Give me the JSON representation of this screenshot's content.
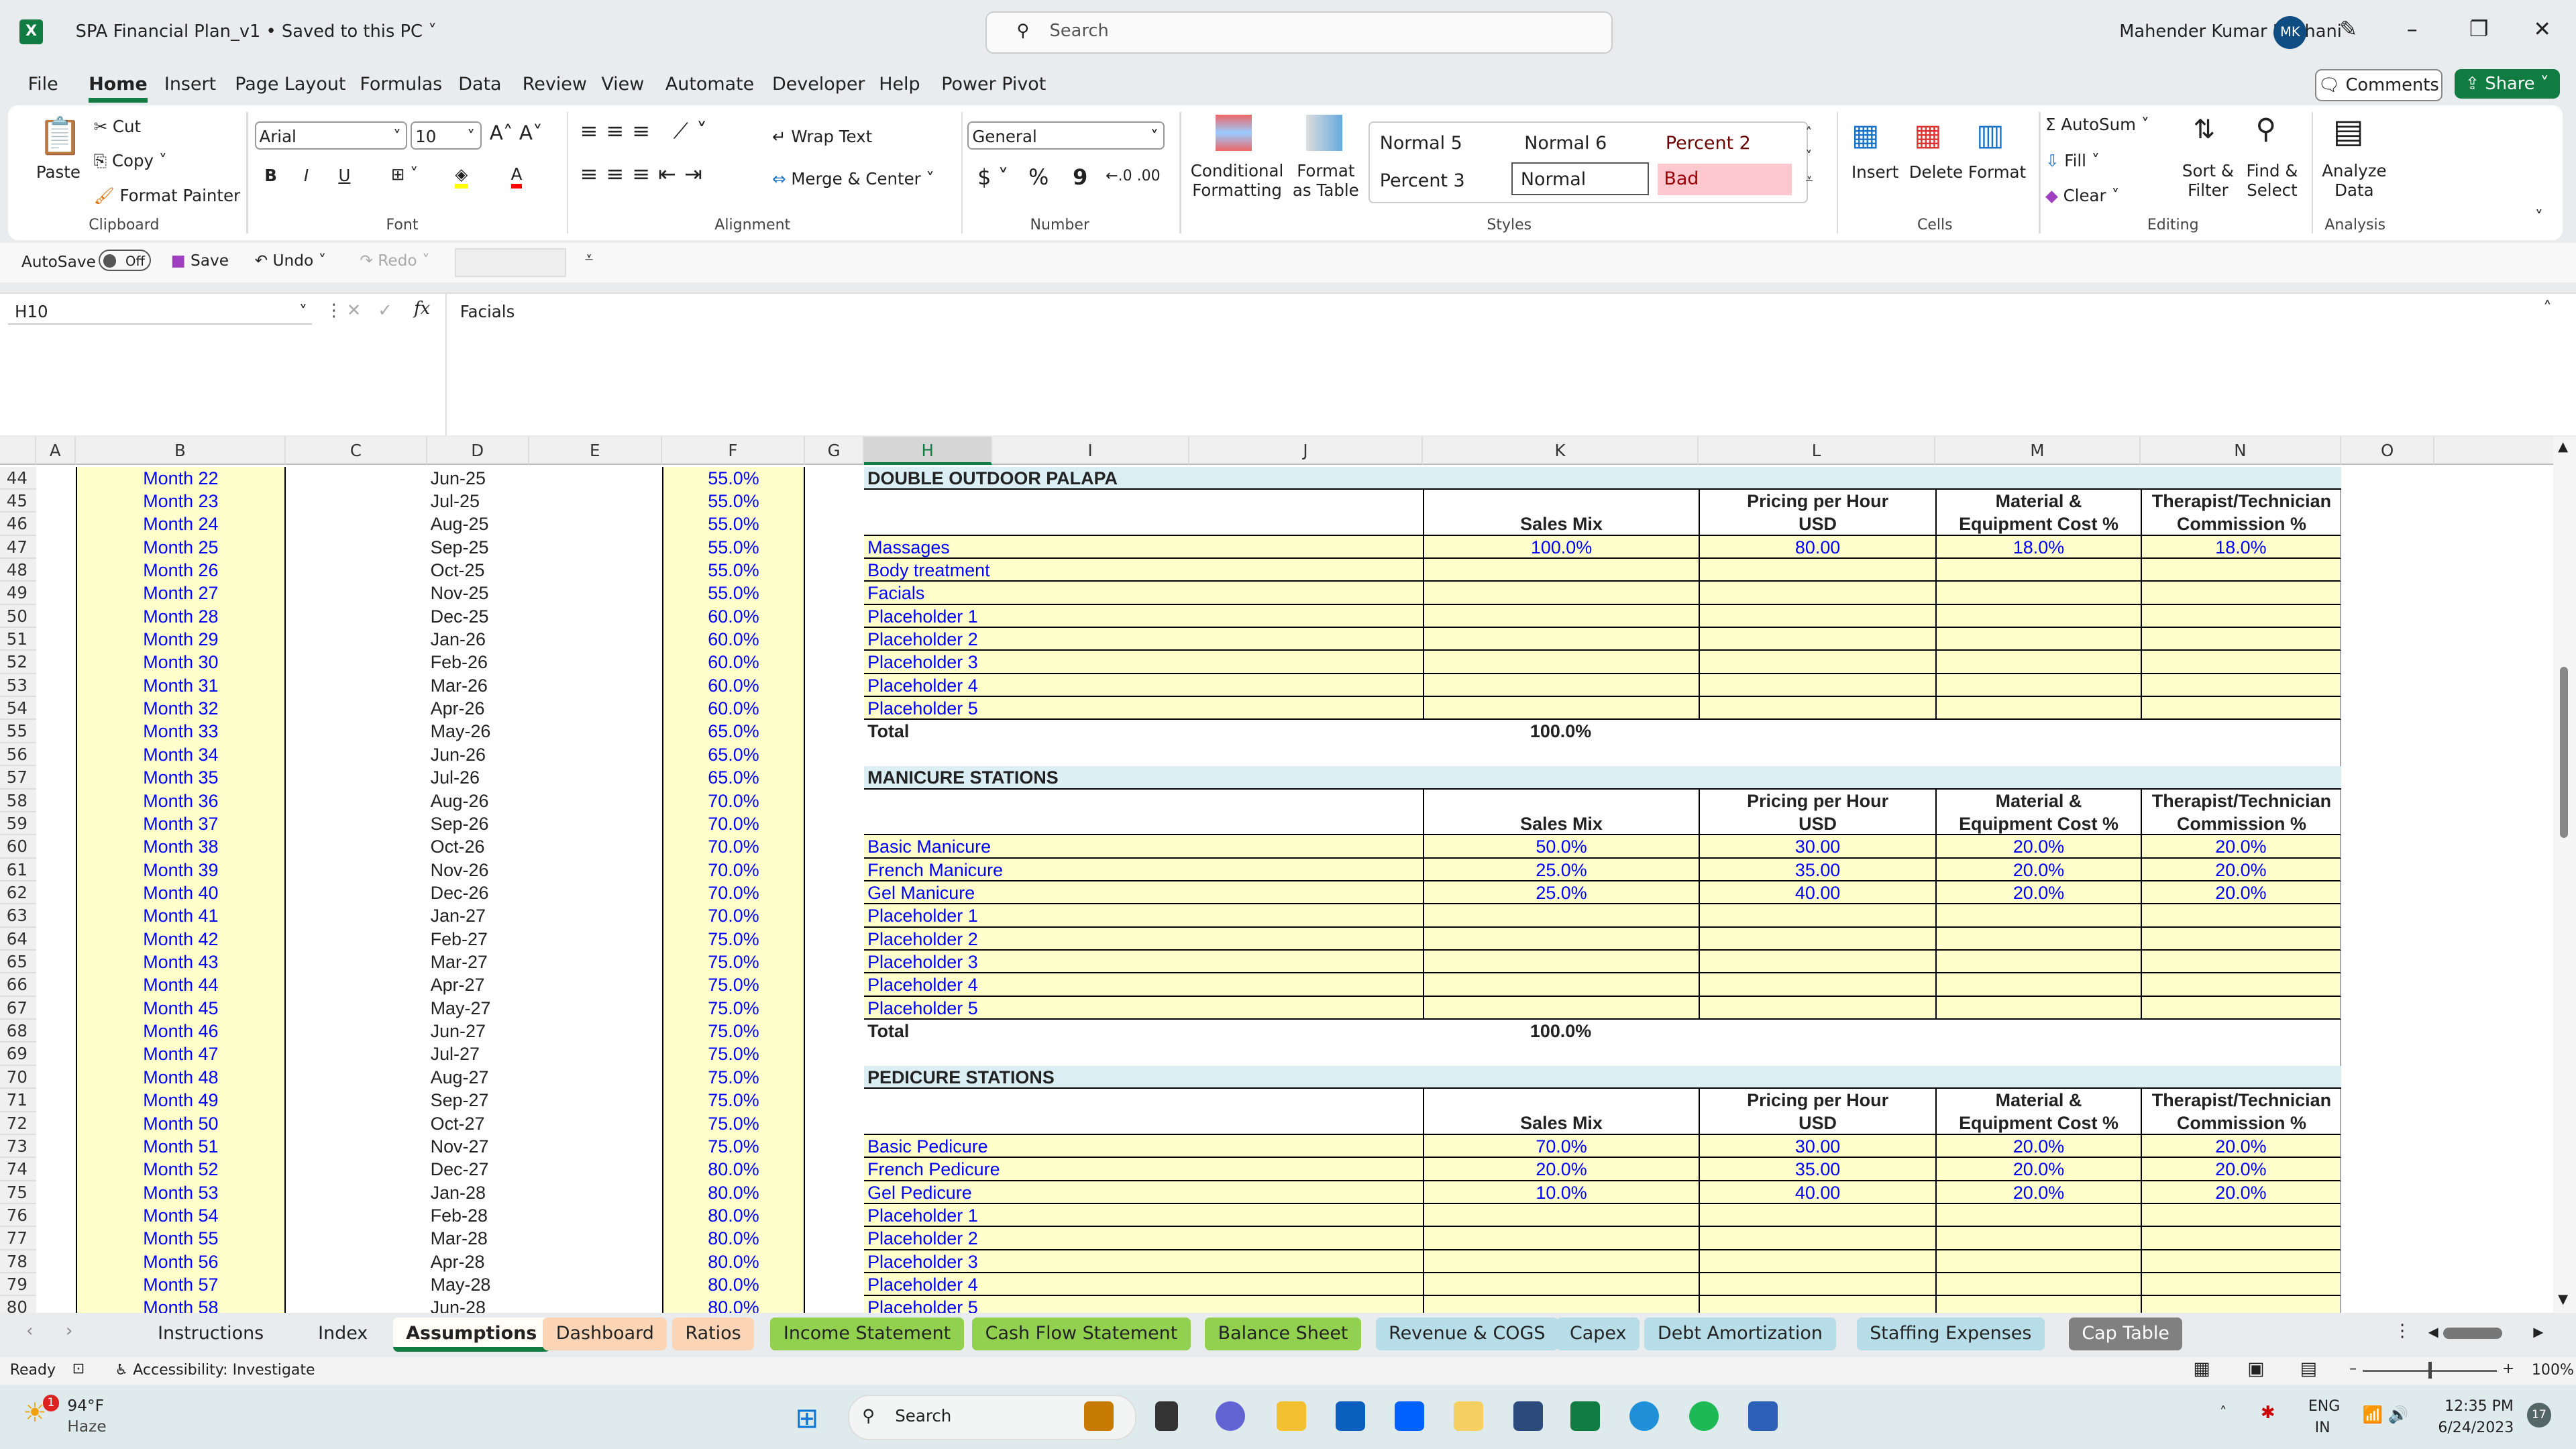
{
  "window": {
    "title": "SPA Financial Plan_v1 • Saved to this PC ˅",
    "search_placeholder": "Search",
    "user": "Mahender Kumar Punhani",
    "avatar": "MK"
  },
  "menu": [
    "File",
    "Home",
    "Insert",
    "Page Layout",
    "Formulas",
    "Data",
    "Review",
    "View",
    "Automate",
    "Developer",
    "Help",
    "Power Pivot"
  ],
  "menu_active": "Home",
  "actions": {
    "comments": "Comments",
    "share": "Share"
  },
  "ribbon": {
    "clipboard": {
      "paste": "Paste",
      "cut": "Cut",
      "copy": "Copy",
      "format_painter": "Format Painter",
      "label": "Clipboard"
    },
    "font": {
      "name": "Arial",
      "size": "10",
      "label": "Font",
      "bold": "B",
      "italic": "I",
      "underline": "U"
    },
    "alignment": {
      "wrap": "Wrap Text",
      "merge": "Merge & Center",
      "label": "Alignment"
    },
    "number": {
      "format": "General",
      "label": "Number",
      "currency": "$",
      "percent": "%",
      "comma": "9"
    },
    "styles": {
      "conditional": "Conditional Formatting",
      "format_table": "Format as Table",
      "cells": [
        "Normal 5",
        "Normal 6",
        "Percent 2",
        "Percent 3",
        "Normal",
        "Bad"
      ],
      "label": "Styles"
    },
    "cells": {
      "insert": "Insert",
      "delete": "Delete",
      "format": "Format",
      "label": "Cells"
    },
    "editing": {
      "autosum": "AutoSum",
      "fill": "Fill",
      "clear": "Clear",
      "sort": "Sort & Filter",
      "find": "Find & Select",
      "label": "Editing"
    },
    "analysis": {
      "analyze": "Analyze Data",
      "label": "Analysis"
    }
  },
  "qat": {
    "autosave": "AutoSave",
    "toggle": "Off",
    "save": "Save",
    "undo": "Undo",
    "redo": "Redo"
  },
  "formula_bar": {
    "name_box": "H10",
    "fx": "fx",
    "content": "Facials"
  },
  "columns": [
    "A",
    "B",
    "C",
    "D",
    "E",
    "F",
    "G",
    "H",
    "I",
    "J",
    "K",
    "L",
    "M",
    "N",
    "O"
  ],
  "selected_column": "H",
  "first_row": 44,
  "left_table": {
    "months": [
      "Month 22",
      "Month 23",
      "Month 24",
      "Month 25",
      "Month 26",
      "Month 27",
      "Month 28",
      "Month 29",
      "Month 30",
      "Month 31",
      "Month 32",
      "Month 33",
      "Month 34",
      "Month 35",
      "Month 36",
      "Month 37",
      "Month 38",
      "Month 39",
      "Month 40",
      "Month 41",
      "Month 42",
      "Month 43",
      "Month 44",
      "Month 45",
      "Month 46",
      "Month 47",
      "Month 48",
      "Month 49",
      "Month 50",
      "Month 51",
      "Month 52",
      "Month 53",
      "Month 54",
      "Month 55",
      "Month 56",
      "Month 57",
      "Month 58"
    ],
    "dates": [
      "Jun-25",
      "Jul-25",
      "Aug-25",
      "Sep-25",
      "Oct-25",
      "Nov-25",
      "Dec-25",
      "Jan-26",
      "Feb-26",
      "Mar-26",
      "Apr-26",
      "May-26",
      "Jun-26",
      "Jul-26",
      "Aug-26",
      "Sep-26",
      "Oct-26",
      "Nov-26",
      "Dec-26",
      "Jan-27",
      "Feb-27",
      "Mar-27",
      "Apr-27",
      "May-27",
      "Jun-27",
      "Jul-27",
      "Aug-27",
      "Sep-27",
      "Oct-27",
      "Nov-27",
      "Dec-27",
      "Jan-28",
      "Feb-28",
      "Mar-28",
      "Apr-28",
      "May-28",
      "Jun-28"
    ],
    "pct": [
      "55.0%",
      "55.0%",
      "55.0%",
      "55.0%",
      "55.0%",
      "55.0%",
      "60.0%",
      "60.0%",
      "60.0%",
      "60.0%",
      "60.0%",
      "65.0%",
      "65.0%",
      "65.0%",
      "70.0%",
      "70.0%",
      "70.0%",
      "70.0%",
      "70.0%",
      "70.0%",
      "75.0%",
      "75.0%",
      "75.0%",
      "75.0%",
      "75.0%",
      "75.0%",
      "75.0%",
      "75.0%",
      "75.0%",
      "75.0%",
      "80.0%",
      "80.0%",
      "80.0%",
      "80.0%",
      "80.0%",
      "80.0%",
      "80.0%"
    ]
  },
  "headers": {
    "sales_mix": "Sales Mix",
    "pricing": [
      "Pricing per Hour",
      "USD"
    ],
    "material": [
      "Material &",
      "Equipment Cost %"
    ],
    "commission": [
      "Therapist/Technician",
      "Commission %"
    ],
    "total": "Total"
  },
  "sections": [
    {
      "title": "DOUBLE OUTDOOR PALAPA",
      "total": "100.0%",
      "items": [
        {
          "name": "Massages",
          "mix": "100.0%",
          "price": "80.00",
          "material": "18.0%",
          "commission": "18.0%"
        },
        {
          "name": "Body treatment"
        },
        {
          "name": "Facials"
        },
        {
          "name": "Placeholder 1"
        },
        {
          "name": "Placeholder 2"
        },
        {
          "name": "Placeholder 3"
        },
        {
          "name": "Placeholder 4"
        },
        {
          "name": "Placeholder 5"
        }
      ]
    },
    {
      "title": "MANICURE STATIONS",
      "total": "100.0%",
      "items": [
        {
          "name": "Basic Manicure",
          "mix": "50.0%",
          "price": "30.00",
          "material": "20.0%",
          "commission": "20.0%"
        },
        {
          "name": "French Manicure",
          "mix": "25.0%",
          "price": "35.00",
          "material": "20.0%",
          "commission": "20.0%"
        },
        {
          "name": "Gel Manicure",
          "mix": "25.0%",
          "price": "40.00",
          "material": "20.0%",
          "commission": "20.0%"
        },
        {
          "name": "Placeholder 1"
        },
        {
          "name": "Placeholder 2"
        },
        {
          "name": "Placeholder 3"
        },
        {
          "name": "Placeholder 4"
        },
        {
          "name": "Placeholder 5"
        }
      ]
    },
    {
      "title": "PEDICURE STATIONS",
      "items": [
        {
          "name": "Basic Pedicure",
          "mix": "70.0%",
          "price": "30.00",
          "material": "20.0%",
          "commission": "20.0%"
        },
        {
          "name": "French Pedicure",
          "mix": "20.0%",
          "price": "35.00",
          "material": "20.0%",
          "commission": "20.0%"
        },
        {
          "name": "Gel Pedicure",
          "mix": "10.0%",
          "price": "40.00",
          "material": "20.0%",
          "commission": "20.0%"
        },
        {
          "name": "Placeholder 1"
        },
        {
          "name": "Placeholder 2"
        },
        {
          "name": "Placeholder 3"
        },
        {
          "name": "Placeholder 4"
        },
        {
          "name": "Placeholder 5"
        }
      ]
    }
  ],
  "sheet_tabs": [
    {
      "label": "Instructions",
      "color": ""
    },
    {
      "label": "Index",
      "color": ""
    },
    {
      "label": "Assumptions",
      "color": "",
      "active": true
    },
    {
      "label": "Dashboard",
      "color": "#fbd5b5"
    },
    {
      "label": "Ratios",
      "color": "#fbd5b5"
    },
    {
      "label": "Income Statement",
      "color": "#92d050"
    },
    {
      "label": "Cash Flow Statement",
      "color": "#92d050"
    },
    {
      "label": "Balance Sheet",
      "color": "#92d050"
    },
    {
      "label": "Revenue & COGS",
      "color": "#b7dee8"
    },
    {
      "label": "Capex",
      "color": "#b7dee8"
    },
    {
      "label": "Debt Amortization",
      "color": "#b7dee8"
    },
    {
      "label": "Staffing Expenses",
      "color": "#b7dee8"
    },
    {
      "label": "Cap Table",
      "color": "#808080"
    }
  ],
  "status": {
    "ready": "Ready",
    "accessibility": "Accessibility: Investigate",
    "zoom": "100%"
  },
  "taskbar": {
    "temp": "94°F",
    "weather": "Haze",
    "search": "Search",
    "lang1": "ENG",
    "lang2": "IN",
    "time": "12:35 PM",
    "date": "6/24/2023",
    "badge": "17",
    "weather_badge": "1"
  },
  "colors": {
    "accent": "#107c41",
    "input_fill": "#ffffcc",
    "section_fill": "#daeef3",
    "input_text": "#0000ff"
  }
}
